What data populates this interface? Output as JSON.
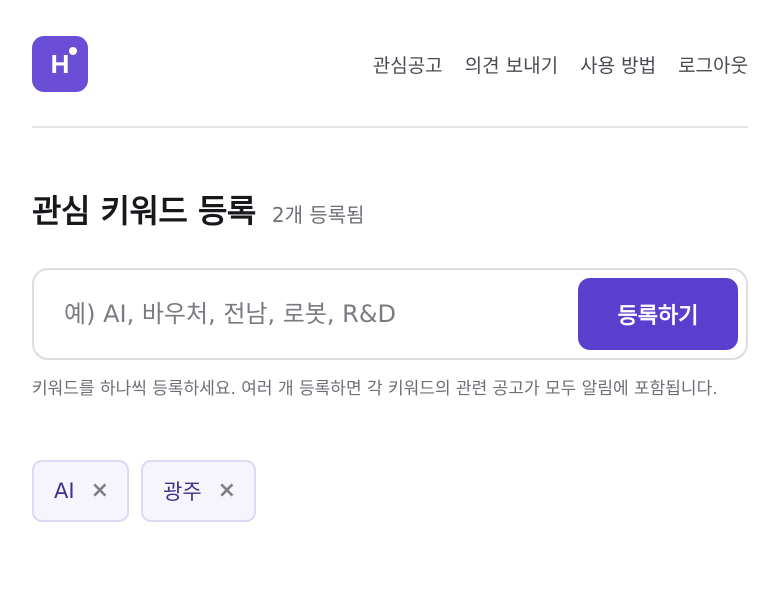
{
  "header": {
    "logo_letter": "H",
    "nav": [
      {
        "label": "관심공고"
      },
      {
        "label": "의견 보내기"
      },
      {
        "label": "사용 방법"
      },
      {
        "label": "로그아웃"
      }
    ]
  },
  "main": {
    "title": "관심 키워드 등록",
    "count_text": "2개 등록됨",
    "input": {
      "value": "",
      "placeholder": "예) AI, 바우처, 전남, 로봇, R&D"
    },
    "submit_label": "등록하기",
    "help_text": "키워드를 하나씩 등록하세요. 여러 개 등록하면 각 키워드의 관련 공고가 모두 알림에 포함됩니다.",
    "tags": [
      {
        "label": "AI",
        "remove_icon": "×"
      },
      {
        "label": "광주",
        "remove_icon": "×"
      }
    ]
  },
  "colors": {
    "brand": "#6a4fd6",
    "button": "#5a3fcf",
    "tag_bg": "#f6f4fd",
    "tag_border": "#ddd8f3"
  }
}
